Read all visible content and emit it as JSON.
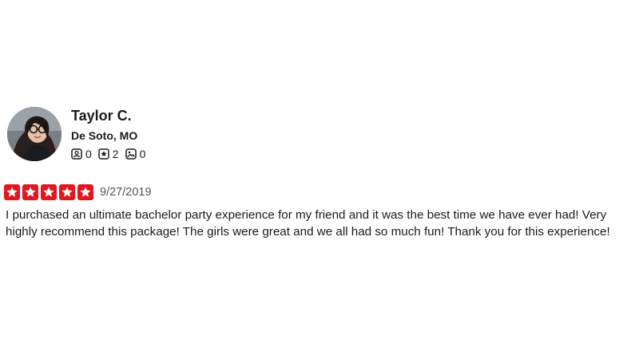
{
  "review": {
    "user": {
      "name": "Taylor C.",
      "location": "De Soto, MO",
      "stats": {
        "friends": "0",
        "reviews": "2",
        "photos": "0"
      }
    },
    "rating": {
      "stars": 5,
      "max_stars": 5,
      "color": "#e4161f"
    },
    "date": "9/27/2019",
    "text": "I purchased an ultimate bachelor party experience for my friend and it was the best time we have ever had! Very highly recommend this package! The girls were great and we all had so much fun! Thank you for this experience!"
  },
  "icons": {
    "friends": "friends-icon",
    "reviews": "star-review-icon",
    "photos": "photo-icon"
  }
}
